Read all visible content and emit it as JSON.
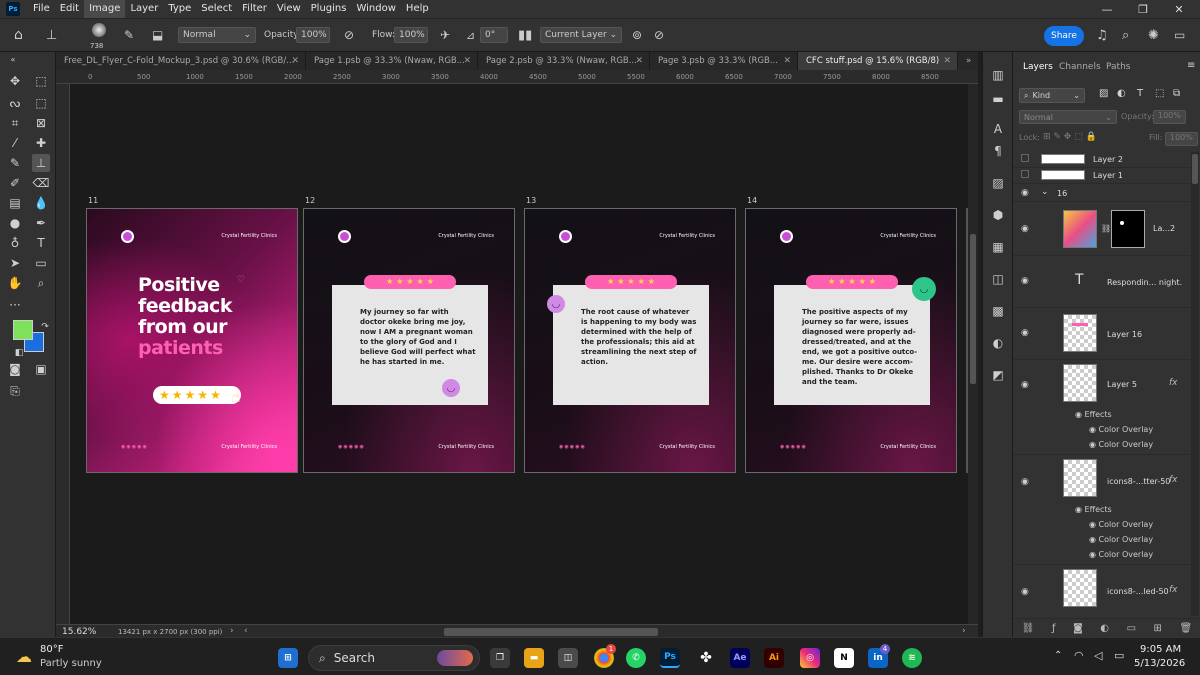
{
  "app": {
    "logo": "Ps",
    "menu": [
      "File",
      "Edit",
      "Image",
      "Layer",
      "Type",
      "Select",
      "Filter",
      "View",
      "Plugins",
      "Window",
      "Help"
    ],
    "active_menu": "Image"
  },
  "options": {
    "brush_size": "738",
    "mode": "Normal",
    "opacity_label": "Opacity:",
    "opacity": "100%",
    "flow_label": "Flow:",
    "flow": "100%",
    "angle": "0°",
    "sample": "Current Layer",
    "share": "Share"
  },
  "tabs": [
    {
      "label": "Free_DL_Flyer_C-Fold_Mockup_3.psd @ 30.6% (RGB/...",
      "active": false
    },
    {
      "label": "Page 1.psb @ 33.3% (Nwaw, RGB...",
      "active": false
    },
    {
      "label": "Page 2.psb @ 33.3% (Nwaw, RGB...",
      "active": false
    },
    {
      "label": "Page 3.psb @ 33.3% (RGB...",
      "active": false
    },
    {
      "label": "CFC stuff.psd @ 15.6% (RGB/8)",
      "active": true
    }
  ],
  "ruler": [
    "0",
    "500",
    "1000",
    "1500",
    "2000",
    "2500",
    "3000",
    "3500",
    "4000",
    "4500",
    "5000",
    "5500",
    "6000",
    "6500",
    "7000",
    "7500",
    "8000",
    "8500"
  ],
  "pages": [
    {
      "num": "11",
      "brand": "Crystal Fertility Clinics",
      "footer": "Crystal Fertility Clinics",
      "social": "◉◉◉◉◉",
      "title_lines": [
        "Positive",
        "feedback",
        "from our"
      ],
      "title_pink": "patients"
    },
    {
      "num": "12",
      "brand": "Crystal Fertility Clinics",
      "footer": "Crystal Fertility Clinics",
      "social": "◉◉◉◉◉",
      "text": "My journey so far with doctor okeke bring me joy, now I AM a pregnant woman to the glory of God and I believe God will perfect what he has started in me."
    },
    {
      "num": "13",
      "brand": "Crystal Fertility Clinics",
      "footer": "Crystal Fertility Clinics",
      "social": "◉◉◉◉◉",
      "text": "The root cause of whatever is happening to my body was determined with the help of the professionals; this aid at streamlining the next step of action."
    },
    {
      "num": "14",
      "brand": "Crystal Fertility Clinics",
      "footer": "Crystal Fertility Clinics",
      "social": "◉◉◉◉◉",
      "text": "The positive aspects of my journey so far were, issues diagnosed were properly ad-dressed/treated, and at the end, we got a positive outco-me. Our desire were accom-plished. Thanks to Dr Okeke and the team."
    }
  ],
  "rating_stars": 5,
  "status": {
    "zoom": "15.62%",
    "doc": "13421 px x 2700 px (300 ppi)"
  },
  "layers_panel": {
    "tabs": [
      "Layers",
      "Channels",
      "Paths"
    ],
    "filter": "Kind",
    "blend": "Normal",
    "opacity_label": "Opacity:",
    "opacity": "100%",
    "lock_label": "Lock:",
    "fill_label": "Fill:",
    "fill": "100%",
    "layers": [
      {
        "name": "Layer 2"
      },
      {
        "name": "Layer 1"
      },
      {
        "name": "16"
      },
      {
        "name": "La...2"
      },
      {
        "name": "Respondin... night."
      },
      {
        "name": "Layer 16"
      },
      {
        "name": "Layer 5"
      },
      {
        "name": "icons8-...tter-50"
      },
      {
        "name": "icons8-...led-50"
      }
    ],
    "effects_label": "Effects",
    "color_overlay": "Color Overlay",
    "fx": "fx"
  },
  "taskbar": {
    "temp": "80°F",
    "weather": "Partly sunny",
    "search": "Search",
    "time": "9:05 AM",
    "date": "5/13/2026",
    "badges": {
      "chrome": "1",
      "linkedin": "4"
    }
  },
  "colors": {
    "accent": "#1473e6",
    "pink": "#ff5fb0",
    "foreground": "#7fe05a",
    "background": "#1a6fe0"
  }
}
